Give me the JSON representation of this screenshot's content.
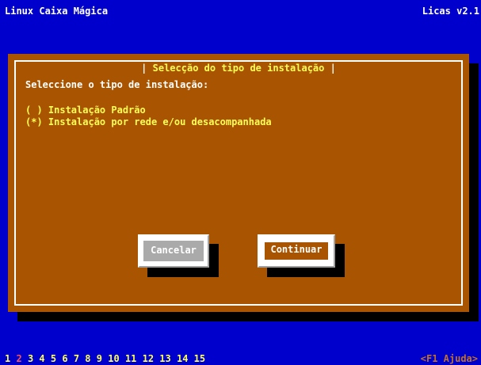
{
  "header": {
    "title": "Linux Caixa Mágica",
    "version": "Licas v2.1"
  },
  "dialog": {
    "title": "Selecção do tipo de instalação",
    "prompt": "Seleccione o tipo de instalação:",
    "options": [
      {
        "label": "( ) Instalação Padrão",
        "selected": false
      },
      {
        "label": "(*) Instalação por rede e/ou desacompanhada",
        "selected": true
      }
    ],
    "buttons": {
      "cancel": "Cancelar",
      "continue": "Continuar"
    }
  },
  "footer": {
    "steps": [
      "1",
      "2",
      "3",
      "4",
      "5",
      "6",
      "7",
      "8",
      "9",
      "10",
      "11",
      "12",
      "13",
      "14",
      "15"
    ],
    "current_step": "2",
    "help": "<F1 Ajuda>"
  },
  "colors": {
    "background": "#0000cc",
    "dialog": "#a85400",
    "highlight_text": "#ffff55",
    "current_step": "#ff5555"
  }
}
